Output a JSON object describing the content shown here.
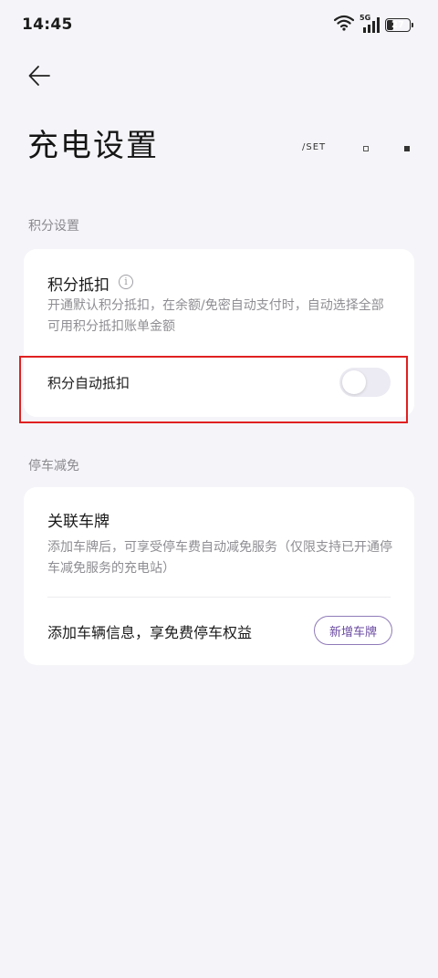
{
  "status_bar": {
    "time": "14:45",
    "network": "5G",
    "battery": "27",
    "battery_level": 0.27
  },
  "header": {
    "title": "充电设置",
    "set_label": "/SET"
  },
  "points_section": {
    "label": "积分设置",
    "title": "积分抵扣",
    "description": "开通默认积分抵扣，在余额/免密自动支付时，自动选择全部可用积分抵扣账单金额",
    "toggle_label": "积分自动抵扣",
    "toggle_on": false
  },
  "parking_section": {
    "label": "停车减免",
    "title": "关联车牌",
    "description": "添加车牌后，可享受停车费自动减免服务（仅限支持已开通停车减免服务的充电站）",
    "row_text": "添加车辆信息，享免费停车权益",
    "add_button": "新增车牌"
  },
  "colors": {
    "background": "#f5f5f9",
    "card": "#ffffff",
    "accent": "#6a4aa0",
    "highlight": "#e02020"
  }
}
